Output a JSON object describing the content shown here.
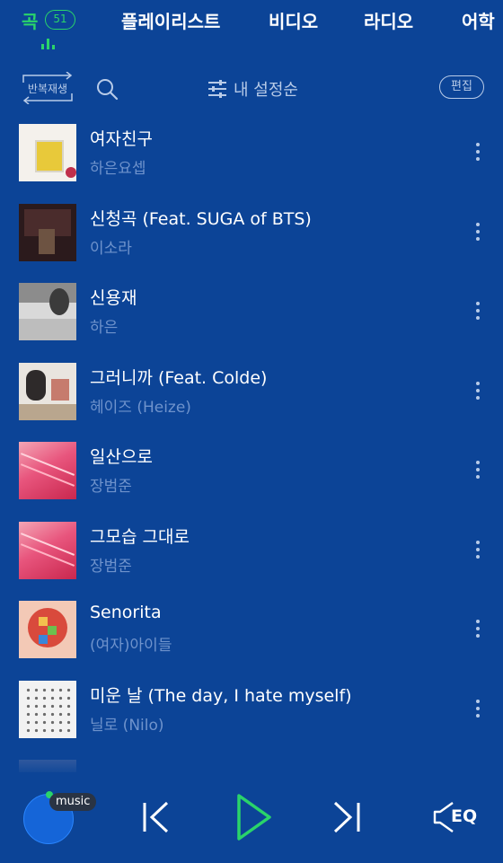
{
  "nav": {
    "tabs": [
      {
        "label": "곡"
      },
      {
        "label": "플레이리스트"
      },
      {
        "label": "비디오"
      },
      {
        "label": "라디오"
      },
      {
        "label": "어학"
      }
    ],
    "song_count": "51"
  },
  "toolbar": {
    "repeat_label": "반복재생",
    "sort_label": "내 설정순",
    "edit_label": "편집"
  },
  "songs": [
    {
      "title": "여자친구",
      "artist": "하은요셉"
    },
    {
      "title": "신청곡 (Feat. SUGA of BTS)",
      "artist": "이소라"
    },
    {
      "title": "신용재",
      "artist": "하은"
    },
    {
      "title": "그러니까 (Feat. Colde)",
      "artist": "헤이즈 (Heize)"
    },
    {
      "title": "일산으로",
      "artist": "장범준"
    },
    {
      "title": "그모습 그대로",
      "artist": "장범준"
    },
    {
      "title": "Senorita",
      "artist": "(여자)아이들"
    },
    {
      "title": "미운 날 (The day, I hate myself)",
      "artist": "닐로 (Nilo)"
    }
  ],
  "player": {
    "source_label": "music",
    "eq_label": "EQ"
  },
  "colors": {
    "background": "#0c4497",
    "accent": "#2ad46a",
    "artist_text": "#6f93cc"
  }
}
